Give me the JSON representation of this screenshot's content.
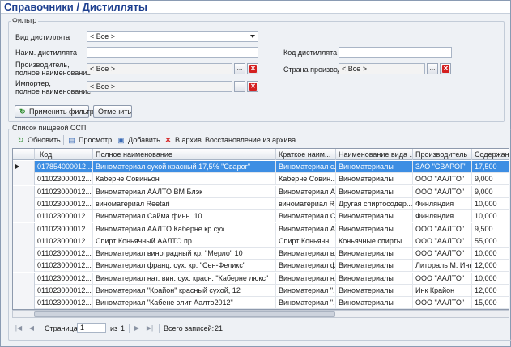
{
  "window": {
    "title": "Справочники / Дистилляты"
  },
  "filter": {
    "group_label": "Фильтр",
    "vid_label": "Вид дистиллята",
    "vid_value": "< Все >",
    "naim_label": "Наим. дистиллята",
    "naim_value": "",
    "kod_label": "Код дистиллята",
    "kod_value": "",
    "proizv_label_1": "Производитель,",
    "proizv_label_2": "полное наименование",
    "proizv_value": "< Все >",
    "strana_label": "Страна производителя",
    "strana_value": "< Все >",
    "importer_label_1": "Импортер,",
    "importer_label_2": "полное наименование",
    "importer_value": "< Все >",
    "ellipsis": "...",
    "clear_glyph": "✕",
    "apply_label": "Применить фильтр",
    "cancel_label": "Отменить"
  },
  "list": {
    "group_label": "Список пищевой ССП",
    "toolbar": {
      "refresh": "Обновить",
      "view": "Просмотр",
      "add": "Добавить",
      "archive": "В архив",
      "restore": "Восстановление из архива"
    },
    "columns": [
      "Код",
      "Полное наименование",
      "Краткое наим...",
      "Наименование вида ...",
      "Производитель",
      "Содержан..."
    ],
    "rows": [
      [
        "017854000012...",
        "Виноматериал сухой красный 17,5% \"Сварог\"",
        "Виноматериал с...",
        "Виноматериалы",
        "ЗАО \"СВАРОГ\"",
        "17,500"
      ],
      [
        "011023000012...",
        "Каберне Совиньон",
        "Каберне Совин...",
        "Виноматериалы",
        "ООО \"ААЛТО\"",
        "9,000"
      ],
      [
        "011023000012...",
        "Виноматериал ААЛТО ВМ Блэк",
        "Виноматериал А...",
        "Виноматериалы",
        "ООО \"ААЛТО\"",
        "9,000"
      ],
      [
        "011023000012...",
        "виноматериал Reetari",
        "виноматериал R...",
        "Другая спиртосодер...",
        "Финляндия",
        "10,000"
      ],
      [
        "011023000012...",
        "Виноматериал Сайма финн. 10",
        "Виноматериал С...",
        "Виноматериалы",
        "Финляндия",
        "10,000"
      ],
      [
        "011023000012...",
        "Виноматериал ААЛТО Каберне кр сух",
        "Виноматериал А...",
        "Виноматериалы",
        "ООО \"ААЛТО\"",
        "9,500"
      ],
      [
        "011023000012...",
        "Спирт Коньячный ААЛТО пр",
        "Спирт Коньячн...",
        "Коньячные спирты",
        "ООО \"ААЛТО\"",
        "55,000"
      ],
      [
        "011023000012...",
        "Виноматериал виноградный кр. \"Мерло\" 10",
        "Виноматериал в...",
        "Виноматериалы",
        "ООО \"ААЛТО\"",
        "10,000"
      ],
      [
        "011023000012...",
        "Виноматериал франц. сух. кр.  \"Сен-Феликс\"",
        "Виноматериал ф...",
        "Виноматериалы",
        "Литораль М. Инк",
        "12,000"
      ],
      [
        "011023000012...",
        "Виноматериал нат. вин. сух. красн. \"Каберне люкс\"",
        "Виноматериал н...",
        "Виноматериалы",
        "ООО \"ААЛТО\"",
        "10,000"
      ],
      [
        "011023000012...",
        "Виноматериал \"Крайон\" красный сухой, 12",
        "Виноматериал \"...",
        "Виноматериалы",
        "Инк Крайон",
        "12,000"
      ],
      [
        "011023000012...",
        "Виноматериал \"Кабене элит Аалто2012\"",
        "Виноматериал \"...",
        "Виноматериалы",
        "ООО \"ААЛТО\"",
        "15,000"
      ]
    ]
  },
  "pager": {
    "page_label": "Страница",
    "page_value": "1",
    "of_label": "из",
    "total_pages": "1",
    "records_label": "Всего записей:",
    "records_value": "21"
  }
}
